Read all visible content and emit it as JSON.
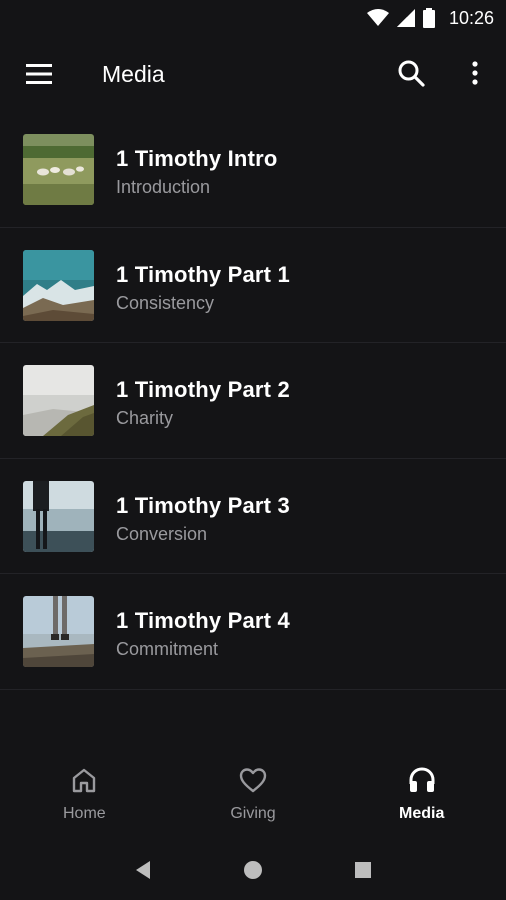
{
  "status": {
    "time": "10:26",
    "icons": [
      "wifi-icon",
      "signal-icon",
      "battery-icon"
    ]
  },
  "app_bar": {
    "title": "Media",
    "icons": [
      "menu-icon",
      "search-icon",
      "more-vert-icon"
    ]
  },
  "media": {
    "items": [
      {
        "title": "1 Timothy Intro",
        "subtitle": "Introduction",
        "thumb": "sheep-field"
      },
      {
        "title": "1 Timothy Part 1",
        "subtitle": "Consistency",
        "thumb": "mountain-sea"
      },
      {
        "title": "1 Timothy Part 2",
        "subtitle": "Charity",
        "thumb": "foggy-hill"
      },
      {
        "title": "1 Timothy Part 3",
        "subtitle": "Conversion",
        "thumb": "person-lake"
      },
      {
        "title": "1 Timothy Part 4",
        "subtitle": "Commitment",
        "thumb": "legs-rocks"
      }
    ]
  },
  "bottom_nav": {
    "items": [
      {
        "label": "Home",
        "icon": "home-icon",
        "active": false
      },
      {
        "label": "Giving",
        "icon": "heart-icon",
        "active": false
      },
      {
        "label": "Media",
        "icon": "headphones-icon",
        "active": true
      }
    ]
  },
  "system_nav": [
    "back-icon",
    "home-circle-icon",
    "recents-icon"
  ],
  "colors": {
    "background": "#141416",
    "divider": "#232327",
    "secondary_text": "#9a9a9e",
    "primary_text": "#ffffff"
  }
}
